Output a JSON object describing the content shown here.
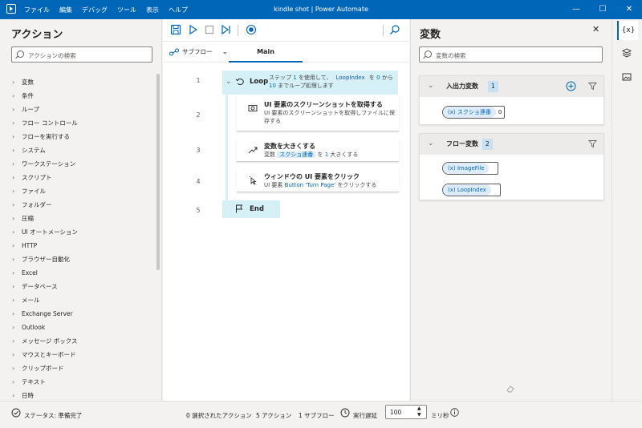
{
  "window": {
    "title": "kindle shot | Power Automate",
    "menu": [
      "ファイル",
      "編集",
      "デバッグ",
      "ツール",
      "表示",
      "ヘルプ"
    ],
    "controls": [
      "—",
      "☐",
      "✕"
    ]
  },
  "actions_panel": {
    "title": "アクション",
    "search_placeholder": "アクションの検索",
    "items": [
      "変数",
      "条件",
      "ループ",
      "フロー コントロール",
      "フローを実行する",
      "システム",
      "ワークステーション",
      "スクリプト",
      "ファイル",
      "フォルダー",
      "圧縮",
      "UI オートメーション",
      "HTTP",
      "ブラウザー自動化",
      "Excel",
      "データベース",
      "メール",
      "Exchange Server",
      "Outlook",
      "メッセージ ボックス",
      "マウスとキーボード",
      "クリップボード",
      "テキスト",
      "日時"
    ]
  },
  "editor": {
    "subflow_label": "サブフロー",
    "tab_main": "Main",
    "line_numbers": [
      "1",
      "2",
      "3",
      "4",
      "5"
    ],
    "loop": {
      "label": "Loop",
      "desc_a": "ステップ",
      "step": "1",
      "desc_b": "を使用して、",
      "var": "LoopIndex",
      "desc_c": "を",
      "start": "0",
      "desc_d": "から",
      "end": "10",
      "desc_e": "までループ処理します"
    },
    "action2": {
      "title": "UI 要素のスクリーンショットを取得する",
      "desc": "UI 要素のスクリーンショットを取得しファイルに保存する"
    },
    "action3": {
      "title": "変数を大きくする",
      "desc_a": "変数",
      "var": "スクショ連番",
      "desc_b": "を",
      "amount": "1",
      "desc_c": "大きくする"
    },
    "action4": {
      "title": "ウィンドウの UI 要素をクリック",
      "desc_a": "UI 要素",
      "target": "Button 'Turn Page'",
      "desc_b": "をクリックする"
    },
    "end_label": "End"
  },
  "variables_panel": {
    "title": "変数",
    "search_placeholder": "変数の検索",
    "io_section": {
      "name": "入出力変数",
      "count": "1",
      "vars": [
        {
          "name": "スクショ連番",
          "value": "0"
        }
      ]
    },
    "flow_section": {
      "name": "フロー変数",
      "count": "2",
      "vars": [
        {
          "name": "ImageFile"
        },
        {
          "name": "LoopIndex"
        }
      ]
    },
    "var_prefix": "(x)"
  },
  "rail": {
    "variables_btn": "{x}"
  },
  "status": {
    "state": "ステータス: 準備完了",
    "selected": "0 選択されたアクション",
    "actions": "5 アクション",
    "subflows": "1 サブフロー",
    "delay_label": "実行遅延",
    "delay_value": "100",
    "unit": "ミリ秒"
  },
  "colors": {
    "titlebar": "#0066b8",
    "loop_highlight": "#d5f0f7",
    "accent": "#0066b8"
  }
}
